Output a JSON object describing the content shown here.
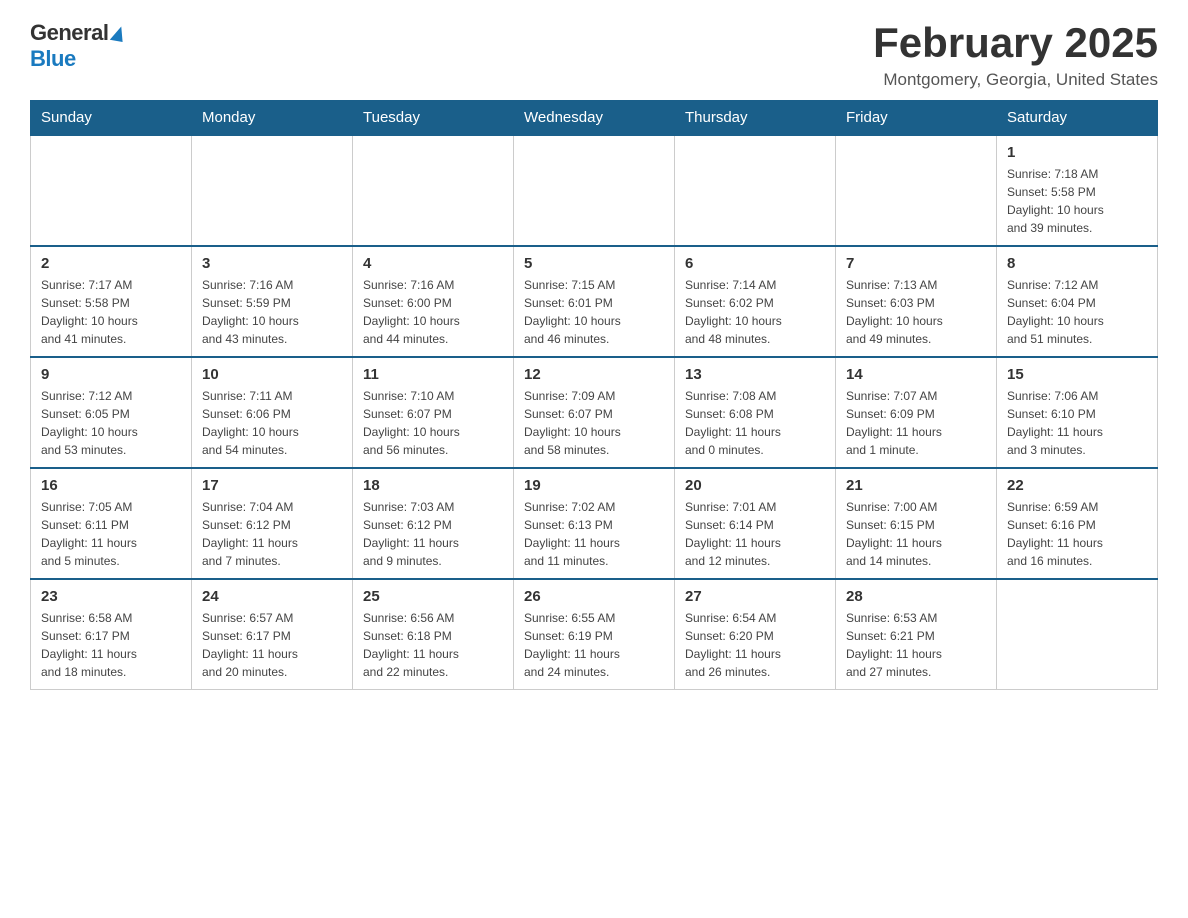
{
  "header": {
    "logo_general": "General",
    "logo_blue": "Blue",
    "title": "February 2025",
    "subtitle": "Montgomery, Georgia, United States"
  },
  "weekdays": [
    "Sunday",
    "Monday",
    "Tuesday",
    "Wednesday",
    "Thursday",
    "Friday",
    "Saturday"
  ],
  "weeks": [
    {
      "days": [
        {
          "date": "",
          "info": ""
        },
        {
          "date": "",
          "info": ""
        },
        {
          "date": "",
          "info": ""
        },
        {
          "date": "",
          "info": ""
        },
        {
          "date": "",
          "info": ""
        },
        {
          "date": "",
          "info": ""
        },
        {
          "date": "1",
          "info": "Sunrise: 7:18 AM\nSunset: 5:58 PM\nDaylight: 10 hours\nand 39 minutes."
        }
      ]
    },
    {
      "days": [
        {
          "date": "2",
          "info": "Sunrise: 7:17 AM\nSunset: 5:58 PM\nDaylight: 10 hours\nand 41 minutes."
        },
        {
          "date": "3",
          "info": "Sunrise: 7:16 AM\nSunset: 5:59 PM\nDaylight: 10 hours\nand 43 minutes."
        },
        {
          "date": "4",
          "info": "Sunrise: 7:16 AM\nSunset: 6:00 PM\nDaylight: 10 hours\nand 44 minutes."
        },
        {
          "date": "5",
          "info": "Sunrise: 7:15 AM\nSunset: 6:01 PM\nDaylight: 10 hours\nand 46 minutes."
        },
        {
          "date": "6",
          "info": "Sunrise: 7:14 AM\nSunset: 6:02 PM\nDaylight: 10 hours\nand 48 minutes."
        },
        {
          "date": "7",
          "info": "Sunrise: 7:13 AM\nSunset: 6:03 PM\nDaylight: 10 hours\nand 49 minutes."
        },
        {
          "date": "8",
          "info": "Sunrise: 7:12 AM\nSunset: 6:04 PM\nDaylight: 10 hours\nand 51 minutes."
        }
      ]
    },
    {
      "days": [
        {
          "date": "9",
          "info": "Sunrise: 7:12 AM\nSunset: 6:05 PM\nDaylight: 10 hours\nand 53 minutes."
        },
        {
          "date": "10",
          "info": "Sunrise: 7:11 AM\nSunset: 6:06 PM\nDaylight: 10 hours\nand 54 minutes."
        },
        {
          "date": "11",
          "info": "Sunrise: 7:10 AM\nSunset: 6:07 PM\nDaylight: 10 hours\nand 56 minutes."
        },
        {
          "date": "12",
          "info": "Sunrise: 7:09 AM\nSunset: 6:07 PM\nDaylight: 10 hours\nand 58 minutes."
        },
        {
          "date": "13",
          "info": "Sunrise: 7:08 AM\nSunset: 6:08 PM\nDaylight: 11 hours\nand 0 minutes."
        },
        {
          "date": "14",
          "info": "Sunrise: 7:07 AM\nSunset: 6:09 PM\nDaylight: 11 hours\nand 1 minute."
        },
        {
          "date": "15",
          "info": "Sunrise: 7:06 AM\nSunset: 6:10 PM\nDaylight: 11 hours\nand 3 minutes."
        }
      ]
    },
    {
      "days": [
        {
          "date": "16",
          "info": "Sunrise: 7:05 AM\nSunset: 6:11 PM\nDaylight: 11 hours\nand 5 minutes."
        },
        {
          "date": "17",
          "info": "Sunrise: 7:04 AM\nSunset: 6:12 PM\nDaylight: 11 hours\nand 7 minutes."
        },
        {
          "date": "18",
          "info": "Sunrise: 7:03 AM\nSunset: 6:12 PM\nDaylight: 11 hours\nand 9 minutes."
        },
        {
          "date": "19",
          "info": "Sunrise: 7:02 AM\nSunset: 6:13 PM\nDaylight: 11 hours\nand 11 minutes."
        },
        {
          "date": "20",
          "info": "Sunrise: 7:01 AM\nSunset: 6:14 PM\nDaylight: 11 hours\nand 12 minutes."
        },
        {
          "date": "21",
          "info": "Sunrise: 7:00 AM\nSunset: 6:15 PM\nDaylight: 11 hours\nand 14 minutes."
        },
        {
          "date": "22",
          "info": "Sunrise: 6:59 AM\nSunset: 6:16 PM\nDaylight: 11 hours\nand 16 minutes."
        }
      ]
    },
    {
      "days": [
        {
          "date": "23",
          "info": "Sunrise: 6:58 AM\nSunset: 6:17 PM\nDaylight: 11 hours\nand 18 minutes."
        },
        {
          "date": "24",
          "info": "Sunrise: 6:57 AM\nSunset: 6:17 PM\nDaylight: 11 hours\nand 20 minutes."
        },
        {
          "date": "25",
          "info": "Sunrise: 6:56 AM\nSunset: 6:18 PM\nDaylight: 11 hours\nand 22 minutes."
        },
        {
          "date": "26",
          "info": "Sunrise: 6:55 AM\nSunset: 6:19 PM\nDaylight: 11 hours\nand 24 minutes."
        },
        {
          "date": "27",
          "info": "Sunrise: 6:54 AM\nSunset: 6:20 PM\nDaylight: 11 hours\nand 26 minutes."
        },
        {
          "date": "28",
          "info": "Sunrise: 6:53 AM\nSunset: 6:21 PM\nDaylight: 11 hours\nand 27 minutes."
        },
        {
          "date": "",
          "info": ""
        }
      ]
    }
  ]
}
